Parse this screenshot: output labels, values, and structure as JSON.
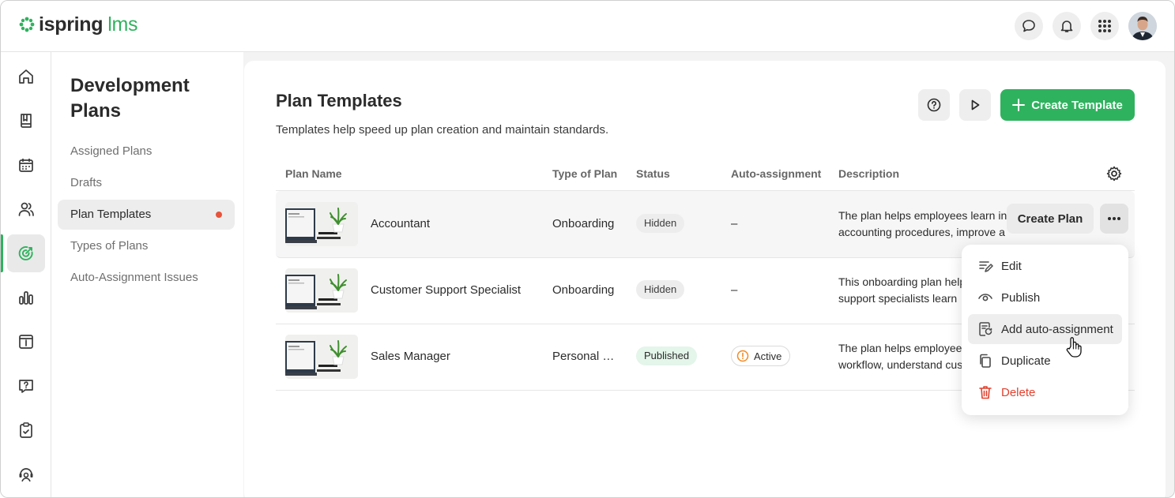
{
  "app": {
    "logo_word_1": "ispring",
    "logo_word_2": "lms",
    "brand_color": "#2fb25e"
  },
  "header": {
    "icons": [
      "chat-icon",
      "bell-icon",
      "apps-grid-icon",
      "user-avatar"
    ]
  },
  "rail": {
    "items": [
      "home-icon",
      "book-icon",
      "calendar-icon",
      "users-icon",
      "target-icon",
      "bar-chart-icon",
      "archive-icon",
      "question-icon",
      "clipboard-check-icon",
      "support-agent-icon"
    ],
    "active": "target-icon"
  },
  "subnav": {
    "title": "Development Plans",
    "items": [
      {
        "label": "Assigned Plans"
      },
      {
        "label": "Drafts"
      },
      {
        "label": "Plan Templates",
        "active": true,
        "dot_color": "#e8533a"
      },
      {
        "label": "Types of Plans"
      },
      {
        "label": "Auto-Assignment Issues"
      }
    ]
  },
  "main": {
    "title": "Plan Templates",
    "subtitle": "Templates help speed up plan creation and maintain standards.",
    "create_label": "Create Template",
    "columns": [
      "Plan Name",
      "Type of Plan",
      "Status",
      "Auto-assignment",
      "Description"
    ],
    "rows": [
      {
        "name": "Accountant",
        "type": "Onboarding",
        "status": "Hidden",
        "auto": "–",
        "desc_1": "The plan helps employees learn in",
        "desc_2": "accounting procedures, improve a",
        "create_plan": "Create Plan"
      },
      {
        "name": "Customer Support Specialist",
        "type": "Onboarding",
        "status": "Hidden",
        "auto": "–",
        "desc_1": "This onboarding plan helps",
        "desc_2": "support specialists learn"
      },
      {
        "name": "Sales Manager",
        "type": "Personal development",
        "status": "Published",
        "auto": "Active",
        "desc_1": "The plan helps employees",
        "desc_2": "workflow, understand cus"
      }
    ]
  },
  "menu": {
    "items": [
      {
        "label": "Edit",
        "icon": "edit-list-icon"
      },
      {
        "label": "Publish",
        "icon": "eye-icon"
      },
      {
        "label": "Add auto-assignment",
        "icon": "auto-assign-icon",
        "highlighted": true
      },
      {
        "label": "Duplicate",
        "icon": "copy-icon"
      },
      {
        "label": "Delete",
        "icon": "trash-icon",
        "danger": true,
        "color": "#e0412e"
      }
    ]
  }
}
